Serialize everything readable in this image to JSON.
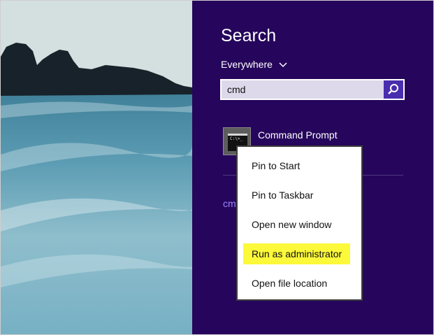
{
  "search": {
    "title": "Search",
    "scope": "Everywhere",
    "query": "cmd"
  },
  "results": [
    {
      "label": "Command Prompt",
      "icon_prompt": "C:\\>_"
    }
  ],
  "suggestion": "cm",
  "context_menu": {
    "items": [
      "Pin to Start",
      "Pin to Taskbar",
      "Open new window",
      "Run as administrator",
      "Open file location"
    ],
    "highlighted": "Run as administrator",
    "highlight_color": "#fcf83a"
  },
  "colors": {
    "pane_bg": "#26065c",
    "search_button": "#4a2dae"
  },
  "icons": {
    "search": "search-icon",
    "scope_toggle": "chevron-down-icon",
    "app": "command-prompt-icon"
  }
}
